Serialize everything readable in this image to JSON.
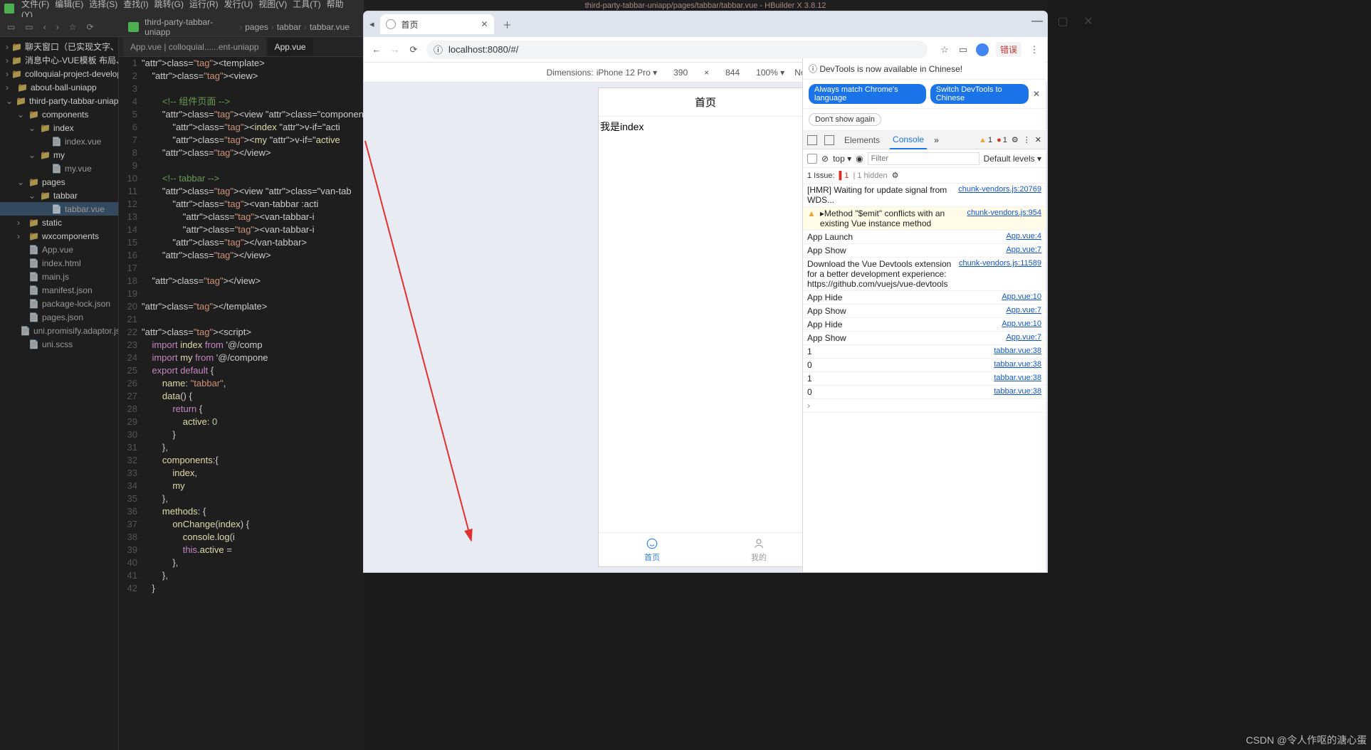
{
  "ide": {
    "menus": [
      "文件(F)",
      "编辑(E)",
      "选择(S)",
      "查找(I)",
      "跳转(G)",
      "运行(R)",
      "发行(U)",
      "视图(V)",
      "工具(T)",
      "帮助(Y)"
    ],
    "breadcrumb": [
      "third-party-tabbar-uniapp",
      "pages",
      "tabbar",
      "tabbar.vue"
    ],
    "title_path": "third-party-tabbar-uniapp/pages/tabbar/tabbar.vue - HBuilder X 3.8.12",
    "tree": [
      {
        "d": 0,
        "t": "聊天窗口（已实现文字、语音、图片发送已经消息撤…",
        "c": "fold",
        "a": "›"
      },
      {
        "d": 0,
        "t": "消息中心-VUE模板 布局、样式、JS分离",
        "c": "fold",
        "a": "›"
      },
      {
        "d": 0,
        "t": "colloquial-project-development-uniapp",
        "c": "fold",
        "a": "›"
      },
      {
        "d": 0,
        "t": "about-ball-uniapp",
        "c": "fold",
        "a": "›"
      },
      {
        "d": 0,
        "t": "third-party-tabbar-uniapp",
        "c": "fold",
        "a": "⌄"
      },
      {
        "d": 1,
        "t": "components",
        "c": "fold",
        "a": "⌄"
      },
      {
        "d": 2,
        "t": "index",
        "c": "fold",
        "a": "⌄"
      },
      {
        "d": 3,
        "t": "index.vue",
        "c": "file"
      },
      {
        "d": 2,
        "t": "my",
        "c": "fold",
        "a": "⌄"
      },
      {
        "d": 3,
        "t": "my.vue",
        "c": "file"
      },
      {
        "d": 1,
        "t": "pages",
        "c": "fold",
        "a": "⌄"
      },
      {
        "d": 2,
        "t": "tabbar",
        "c": "fold",
        "a": "⌄",
        "sel": false
      },
      {
        "d": 3,
        "t": "tabbar.vue",
        "c": "file",
        "sel": true
      },
      {
        "d": 1,
        "t": "static",
        "c": "fold",
        "a": "›"
      },
      {
        "d": 1,
        "t": "wxcomponents",
        "c": "fold",
        "a": "›"
      },
      {
        "d": 1,
        "t": "App.vue",
        "c": "file"
      },
      {
        "d": 1,
        "t": "index.html",
        "c": "file"
      },
      {
        "d": 1,
        "t": "main.js",
        "c": "file"
      },
      {
        "d": 1,
        "t": "manifest.json",
        "c": "file"
      },
      {
        "d": 1,
        "t": "package-lock.json",
        "c": "file"
      },
      {
        "d": 1,
        "t": "pages.json",
        "c": "file"
      },
      {
        "d": 1,
        "t": "uni.promisify.adaptor.js",
        "c": "file"
      },
      {
        "d": 1,
        "t": "uni.scss",
        "c": "file"
      }
    ],
    "tabs": [
      {
        "label": "App.vue | colloquial......ent-uniapp",
        "active": false
      },
      {
        "label": "App.vue",
        "active": true
      }
    ],
    "code": [
      "<template>",
      "    <view>",
      "",
      "        <!-- 组件页面 -->",
      "        <view class=\"componen",
      "            <index v-if=\"acti",
      "            <my v-if=\"active ",
      "        </view>",
      "",
      "        <!-- tabbar -->",
      "        <view class=\"van-tab",
      "            <van-tabbar :acti",
      "                <van-tabbar-i",
      "                <van-tabbar-i",
      "            </van-tabbar>",
      "        </view>",
      "",
      "    </view>",
      "",
      "</template>",
      "",
      "<script>",
      "    import index from '@/comp",
      "    import my from '@/compone",
      "    export default {",
      "        name: \"tabbar\",",
      "        data() {",
      "            return {",
      "                active: 0",
      "            }",
      "        },",
      "        components:{",
      "            index,",
      "            my",
      "        },",
      "        methods: {",
      "            onChange(index) {",
      "                console.log(i",
      "                this.active =",
      "            },",
      "        },",
      "    }"
    ]
  },
  "browser": {
    "tab_title": "首页",
    "url": "localhost:8080/#/",
    "err_badge": "错误",
    "dev": {
      "dim_label": "Dimensions:",
      "device": "iPhone 12 Pro ▾",
      "w": "390",
      "h": "844",
      "zoom": "100% ▾",
      "throttle": "No throttling ▾"
    },
    "phone": {
      "title": "首页",
      "body": "我是index",
      "tabs": [
        {
          "label": "首页",
          "active": true
        },
        {
          "label": "我的",
          "active": false
        }
      ]
    }
  },
  "devtools": {
    "banner": "DevTools is now available in Chinese!",
    "chip1": "Always match Chrome's language",
    "chip2": "Switch DevTools to Chinese",
    "chip3": "Don't show again",
    "tabs": {
      "elements": "Elements",
      "console": "Console"
    },
    "counts": {
      "warn": "1",
      "err": "1"
    },
    "filter": {
      "top": "top ▾",
      "placeholder": "Filter",
      "levels": "Default levels ▾"
    },
    "issues": {
      "label": "1 Issue:",
      "err": "1",
      "hidden": "1 hidden"
    },
    "logs": [
      {
        "msg": "[HMR] Waiting for update signal from WDS...",
        "link": "chunk-vendors.js:20769"
      },
      {
        "msg": "▸Method \"$emit\" conflicts with an existing Vue instance method",
        "link": "chunk-vendors.js:954",
        "warn": true
      },
      {
        "msg": "App Launch",
        "link": "App.vue:4"
      },
      {
        "msg": "App Show",
        "link": "App.vue:7"
      },
      {
        "msg": "Download the Vue Devtools extension for a better development experience:\nhttps://github.com/vuejs/vue-devtools",
        "link": "chunk-vendors.js:11589"
      },
      {
        "msg": "App Hide",
        "link": "App.vue:10"
      },
      {
        "msg": "App Show",
        "link": "App.vue:7"
      },
      {
        "msg": "App Hide",
        "link": "App.vue:10"
      },
      {
        "msg": "App Show",
        "link": "App.vue:7"
      },
      {
        "msg": "1",
        "link": "tabbar.vue:38"
      },
      {
        "msg": "0",
        "link": "tabbar.vue:38"
      },
      {
        "msg": "1",
        "link": "tabbar.vue:38"
      },
      {
        "msg": "0",
        "link": "tabbar.vue:38"
      }
    ],
    "prompt": "›"
  },
  "watermark": "CSDN @令人作呕的溏心蛋"
}
